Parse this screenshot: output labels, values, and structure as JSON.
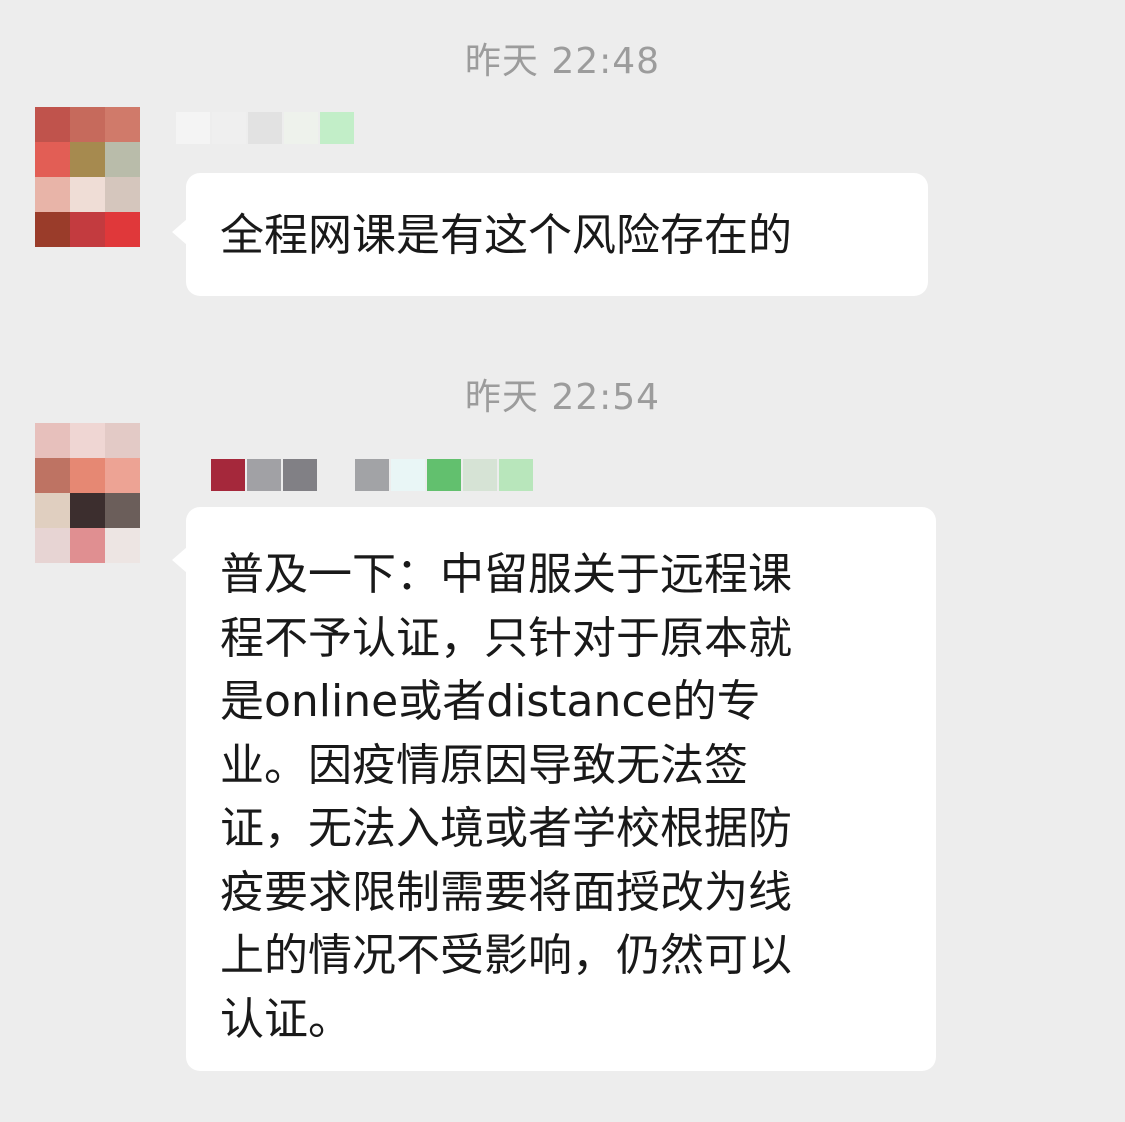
{
  "messages": [
    {
      "timestamp": "昨天 22:48",
      "avatar_colors": [
        "#c0534c",
        "#c66a5c",
        "#d07a6a",
        "#e25e55",
        "#a68a4f",
        "#b9bcaa",
        "#e8b4a8",
        "#efddd6",
        "#d5c6bd",
        "#9a3c2a",
        "#c33b3f",
        "#e0383a"
      ],
      "name_colors": [
        "#f4f4f4",
        "#efefef",
        "#e2e2e2",
        "#eef2ec",
        "#c2eec8"
      ],
      "text_lines": [
        "全程网课是有这个风险存在的"
      ]
    },
    {
      "timestamp": "昨天 22:54",
      "avatar_colors": [
        "#e7c0bc",
        "#efd6d3",
        "#e3cac6",
        "#be7363",
        "#e68873",
        "#eda394",
        "#e0cfc0",
        "#3c2e2e",
        "#6b5e5a",
        "#e7d4d3",
        "#e08f91",
        "#ede5e3"
      ],
      "name_colors": [
        "#a5283b",
        "#a1a1a5",
        "#818085",
        "#ededed",
        "#a2a3a6",
        "#e9f6f6",
        "#62c06e",
        "#d6e3d5",
        "#b8e6bb"
      ],
      "text_lines": [
        "普及一下：中留服关于远程课",
        "程不予认证，只针对于原本就",
        "是online或者distance的专",
        "业。因疫情原因导致无法签",
        "证，无法入境或者学校根据防",
        "疫要求限制需要将面授改为线",
        "上的情况不受影响，仍然可以",
        "认证。"
      ]
    }
  ]
}
